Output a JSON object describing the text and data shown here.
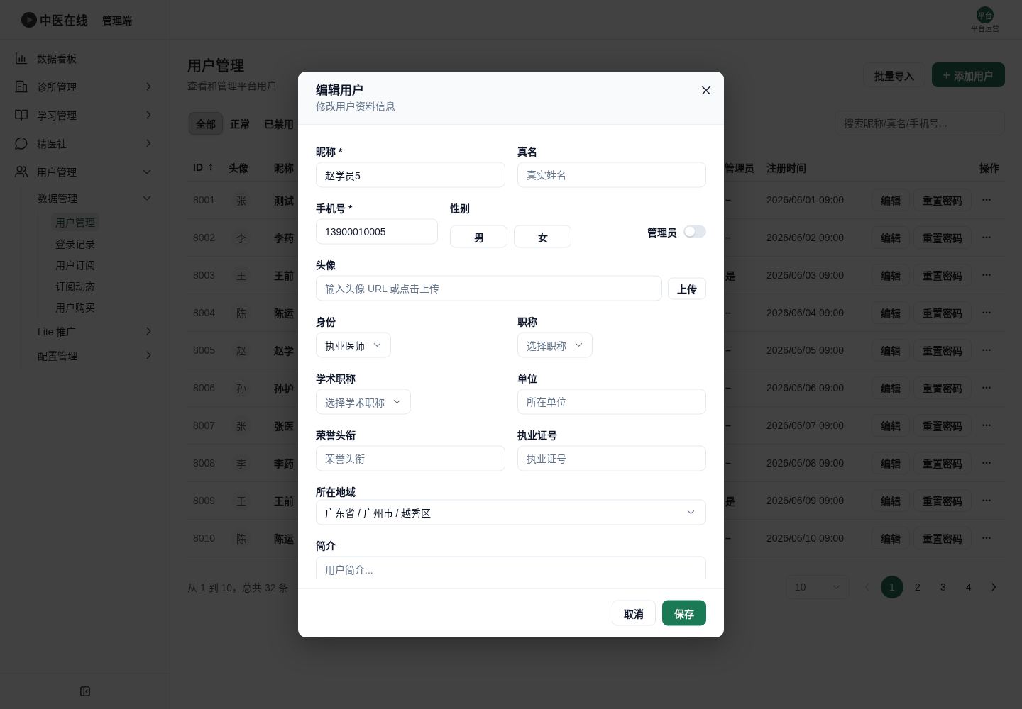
{
  "header": {
    "app_name": "中医在线",
    "app_section": "管理端",
    "user": {
      "avatar": "平台",
      "name": "平台运营"
    }
  },
  "sidebar": {
    "items": [
      {
        "label": "数据看板",
        "selected": false
      },
      {
        "label": "诊所管理",
        "selected": false,
        "expanded": false
      },
      {
        "label": "学习管理",
        "selected": false,
        "expanded": false
      },
      {
        "label": "精医社",
        "selected": false,
        "expanded": false
      },
      {
        "label": "用户管理",
        "selected": false,
        "expanded": true,
        "children": [
          {
            "label": "数据管理",
            "selected": false,
            "expanded": true,
            "children": [
              {
                "label": "用户管理",
                "selected": true
              },
              {
                "label": "登录记录",
                "selected": false
              },
              {
                "label": "用户订阅",
                "selected": false
              },
              {
                "label": "订阅动态",
                "selected": false
              },
              {
                "label": "用户购买",
                "selected": false
              }
            ]
          },
          {
            "label": "Lite 推广",
            "selected": false,
            "expanded": false
          },
          {
            "label": "配置管理",
            "selected": false,
            "expanded": false
          }
        ]
      }
    ]
  },
  "page": {
    "title": "用户管理",
    "subtitle": "查看和管理平台用户",
    "actions": [
      {
        "kind": "secondary",
        "label": "批量导入"
      },
      {
        "kind": "primary",
        "label": "添加用户"
      }
    ],
    "filters": [
      {
        "label": "全部",
        "selected": true
      },
      {
        "label": "正常",
        "selected": false
      },
      {
        "label": "已禁用",
        "selected": false
      }
    ],
    "search": {
      "placeholder": "搜索昵称/真名/手机号..."
    },
    "table": {
      "columns": [
        {
          "label": "ID",
          "sortable": true
        },
        {
          "label": "头像"
        },
        {
          "label": "昵称"
        },
        {
          "label": "管理员"
        },
        {
          "label": "注册时间"
        },
        {
          "label": "操作"
        }
      ],
      "rows": [
        {
          "id": "8001",
          "avatar": "张",
          "nickname": "测试",
          "admin": "–",
          "registered": "2026/06/01 09:00",
          "actions": [
            "编辑",
            "重置密码"
          ]
        },
        {
          "id": "8002",
          "avatar": "李",
          "nickname": "李药",
          "admin": "–",
          "registered": "2026/06/02 09:00",
          "actions": [
            "编辑",
            "重置密码"
          ]
        },
        {
          "id": "8003",
          "avatar": "王",
          "nickname": "王前",
          "admin": "是",
          "registered": "2026/06/03 09:00",
          "actions": [
            "编辑",
            "重置密码"
          ]
        },
        {
          "id": "8004",
          "avatar": "陈",
          "nickname": "陈运",
          "admin": "–",
          "registered": "2026/06/04 09:00",
          "actions": [
            "编辑",
            "重置密码"
          ]
        },
        {
          "id": "8005",
          "avatar": "赵",
          "nickname": "赵学",
          "admin": "–",
          "registered": "2026/06/05 09:00",
          "actions": [
            "编辑",
            "重置密码"
          ]
        },
        {
          "id": "8006",
          "avatar": "孙",
          "nickname": "孙护",
          "admin": "–",
          "registered": "2026/06/06 09:00",
          "actions": [
            "编辑",
            "重置密码"
          ]
        },
        {
          "id": "8007",
          "avatar": "张",
          "nickname": "张医",
          "admin": "–",
          "registered": "2026/06/07 09:00",
          "actions": [
            "编辑",
            "重置密码"
          ]
        },
        {
          "id": "8008",
          "avatar": "李",
          "nickname": "李药",
          "admin": "–",
          "registered": "2026/06/08 09:00",
          "actions": [
            "编辑",
            "重置密码"
          ]
        },
        {
          "id": "8009",
          "avatar": "王",
          "nickname": "王前",
          "admin": "是",
          "registered": "2026/06/09 09:00",
          "actions": [
            "编辑",
            "重置密码"
          ]
        },
        {
          "id": "8010",
          "avatar": "陈",
          "nickname": "陈运",
          "admin": "–",
          "registered": "2026/06/10 09:00",
          "actions": [
            "编辑",
            "重置密码"
          ]
        }
      ]
    },
    "pagination": {
      "summary": "从 1 到 10，总共 32 条",
      "page_size": "10",
      "prev": {
        "disabled": true
      },
      "pages": [
        {
          "label": "1",
          "selected": true
        },
        {
          "label": "2",
          "selected": false
        },
        {
          "label": "3",
          "selected": false
        },
        {
          "label": "4",
          "selected": false
        }
      ],
      "next": {
        "disabled": false
      }
    }
  },
  "dialog": {
    "title": "编辑用户",
    "subtitle": "修改用户资料信息",
    "fields": [
      {
        "kind": "input",
        "label": "昵称 *",
        "value": "赵学员5"
      },
      {
        "kind": "input",
        "label": "真名",
        "placeholder": "真实姓名"
      },
      {
        "kind": "input",
        "label": "手机号 *",
        "value": "13900010005"
      },
      {
        "kind": "choice",
        "label": "性别",
        "options": [
          {
            "label": "男",
            "selected": false
          },
          {
            "label": "女",
            "selected": false
          }
        ]
      },
      {
        "kind": "toggle",
        "label": "管理员",
        "on": false
      },
      {
        "kind": "upload",
        "label": "头像",
        "placeholder": "输入头像 URL 或点击上传",
        "button": "上传"
      },
      {
        "kind": "select",
        "label": "身份",
        "value": "执业医师"
      },
      {
        "kind": "select",
        "label": "职称",
        "placeholder": "选择职称"
      },
      {
        "kind": "select",
        "label": "学术职称",
        "placeholder": "选择学术职称"
      },
      {
        "kind": "input",
        "label": "单位",
        "placeholder": "所在单位"
      },
      {
        "kind": "input",
        "label": "荣誉头衔",
        "placeholder": "荣誉头衔"
      },
      {
        "kind": "input",
        "label": "执业证号",
        "placeholder": "执业证号"
      },
      {
        "kind": "select",
        "label": "所在地域",
        "value": "广东省 / 广州市 / 越秀区"
      },
      {
        "kind": "textarea",
        "label": "简介",
        "placeholder": "用户简介..."
      }
    ],
    "buttons": [
      {
        "kind": "secondary",
        "label": "取消"
      },
      {
        "kind": "primary",
        "label": "保存"
      }
    ]
  }
}
